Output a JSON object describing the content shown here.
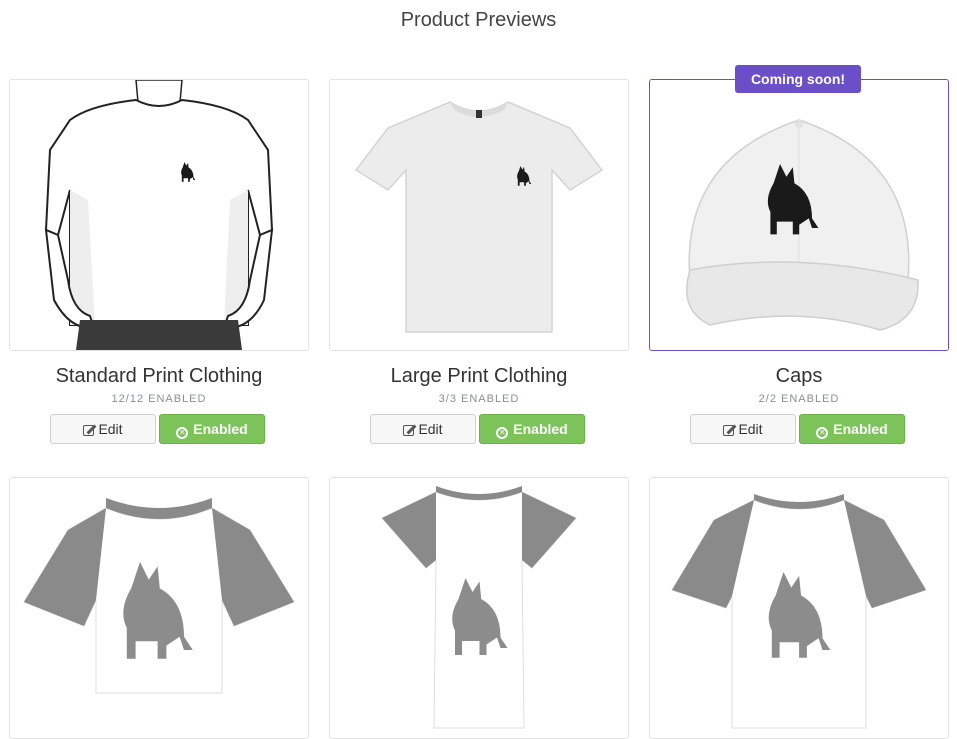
{
  "page": {
    "title": "Product Previews"
  },
  "products": [
    {
      "name": "Standard Print Clothing",
      "status": "12/12 ENABLED",
      "edit_label": "Edit",
      "enabled_label": "Enabled",
      "ribbon": ""
    },
    {
      "name": "Large Print Clothing",
      "status": "3/3 ENABLED",
      "edit_label": "Edit",
      "enabled_label": "Enabled",
      "ribbon": ""
    },
    {
      "name": "Caps",
      "status": "2/2 ENABLED",
      "edit_label": "Edit",
      "enabled_label": "Enabled",
      "ribbon": "Coming soon!"
    },
    {
      "preview": "all-over-print-tee-cropped"
    },
    {
      "preview": "all-over-print-tee-long"
    },
    {
      "preview": "all-over-print-tee"
    }
  ],
  "colors": {
    "accent": "#6a4fc9",
    "enabled": "#7cc35a",
    "sleeve_gray": "#8a8a8a",
    "wolf_black": "#1a1a1a",
    "wolf_gray": "#8c8c8c"
  },
  "icons": {
    "edit": "edit-icon",
    "enabled": "circle-x-icon"
  }
}
